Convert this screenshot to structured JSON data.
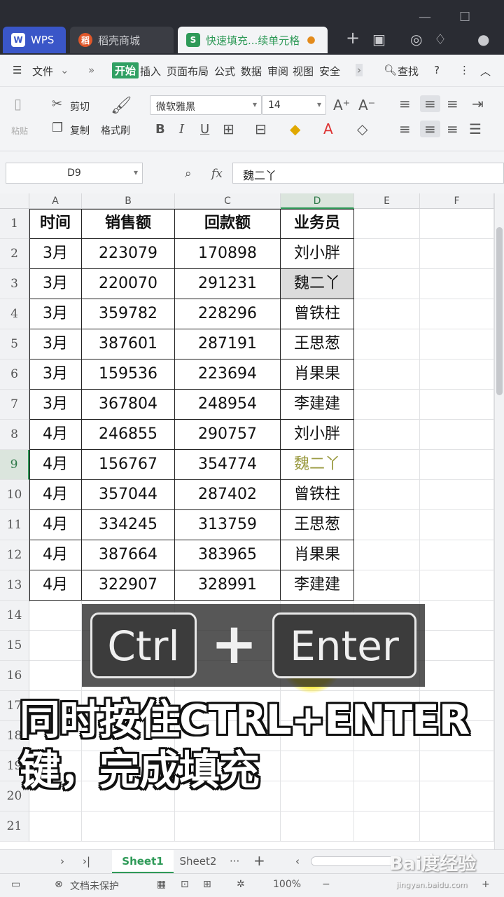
{
  "window": {
    "tabs": [
      {
        "label": "WPS",
        "icon": "W"
      },
      {
        "label": "稻壳商城",
        "icon": "稻"
      },
      {
        "label": "快速填充...续单元格",
        "icon": "S"
      }
    ]
  },
  "menu": {
    "file": "文件",
    "items": [
      "开始",
      "插入",
      "页面布局",
      "公式",
      "数据",
      "审阅",
      "视图",
      "安全"
    ],
    "search": "查找"
  },
  "ribbon": {
    "paste": "粘贴",
    "cut": "剪切",
    "copy": "复制",
    "format_painter": "格式刷",
    "font_name": "微软雅黑",
    "font_size": "14",
    "bold": "B",
    "italic": "I",
    "underline": "U"
  },
  "formula_bar": {
    "name_box": "D9",
    "fx": "fx",
    "value": "魏二丫"
  },
  "sheet": {
    "columns": [
      "A",
      "B",
      "C",
      "D",
      "E",
      "F"
    ],
    "row_numbers": [
      "1",
      "2",
      "3",
      "4",
      "5",
      "6",
      "7",
      "8",
      "9",
      "10",
      "11",
      "12",
      "13",
      "14",
      "15",
      "16",
      "17",
      "18",
      "19",
      "20",
      "21"
    ],
    "headers": [
      "时间",
      "销售额",
      "回款额",
      "业务员"
    ],
    "rows": [
      [
        "3月",
        "223079",
        "170898",
        "刘小胖"
      ],
      [
        "3月",
        "220070",
        "291231",
        "魏二丫"
      ],
      [
        "3月",
        "359782",
        "228296",
        "曾铁柱"
      ],
      [
        "3月",
        "387601",
        "287191",
        "王思葱"
      ],
      [
        "3月",
        "159536",
        "223694",
        "肖果果"
      ],
      [
        "3月",
        "367804",
        "248954",
        "李建建"
      ],
      [
        "4月",
        "246855",
        "290757",
        "刘小胖"
      ],
      [
        "4月",
        "156767",
        "354774",
        "魏二丫"
      ],
      [
        "4月",
        "357044",
        "287402",
        "曾铁柱"
      ],
      [
        "4月",
        "334245",
        "313759",
        "王思葱"
      ],
      [
        "4月",
        "387664",
        "383965",
        "肖果果"
      ],
      [
        "4月",
        "322907",
        "328991",
        "李建建"
      ]
    ]
  },
  "overlay": {
    "key1": "Ctrl",
    "plus": "+",
    "key2": "Enter",
    "caption_line1": "同时按住CTRL+ENTER",
    "caption_line2": "键，完成填充"
  },
  "sheet_tabs": {
    "sheet1": "Sheet1",
    "sheet2": "Sheet2",
    "more": "···",
    "add": "+"
  },
  "status": {
    "protect": "文档未保护",
    "zoom": "100%"
  },
  "watermark": {
    "main": "Bai度经验",
    "sub": "jingyan.baidu.com"
  }
}
